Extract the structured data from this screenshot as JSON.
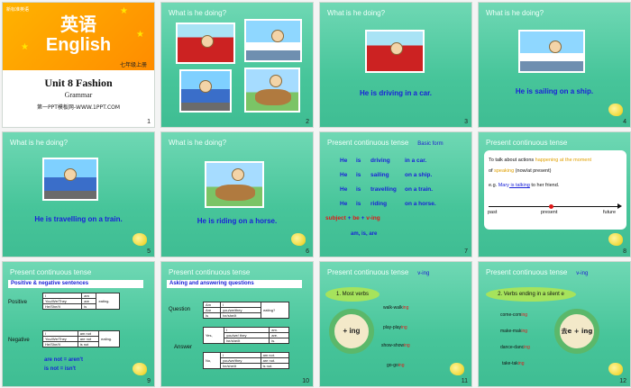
{
  "slides": [
    {
      "num": "1",
      "title_cn": "英语",
      "title_en": "English",
      "grade": "七年级上册",
      "unit": "Unit 8 Fashion",
      "sub": "Grammar",
      "site": "第一PPT模板网-WWW.1PPT.COM",
      "logo": "新标准英语"
    },
    {
      "num": "2",
      "header": "What is he doing?"
    },
    {
      "num": "3",
      "header": "What is he doing?",
      "sentence": "He is driving in a car."
    },
    {
      "num": "4",
      "header": "What is he doing?",
      "sentence": "He is sailing on a ship."
    },
    {
      "num": "5",
      "header": "What is he doing?",
      "sentence": "He is travelling on a train."
    },
    {
      "num": "6",
      "header": "What is he doing?",
      "sentence": "He is riding on a horse."
    },
    {
      "num": "7",
      "header": "Present continuous tense",
      "subheader": "Basic form",
      "rows": [
        [
          "He",
          "is",
          "driving",
          "in a car."
        ],
        [
          "He",
          "is",
          "sailing",
          "on a ship."
        ],
        [
          "He",
          "is",
          "travelling",
          "on a train."
        ],
        [
          "He",
          "is",
          "riding",
          "on a horse."
        ]
      ],
      "formula": [
        "subject",
        "+",
        "be",
        "+",
        "v-ing"
      ],
      "be_forms": "am, is, are"
    },
    {
      "num": "8",
      "header": "Present continuous tense",
      "line1a": "To talk about actions ",
      "line1b": "happening at the moment",
      "line2a": "of ",
      "line2b": "speaking",
      "line2c": " (now/at present)",
      "eg_a": "e.g. ",
      "eg_b": "Mary",
      "eg_c": " is talking",
      "eg_d": " to her friend.",
      "past": "past",
      "present": "present",
      "future": "future"
    },
    {
      "num": "9",
      "header": "Present continuous tense",
      "bar": "Positive & negative sentences",
      "positive": "Positive",
      "negative": "Negative",
      "pos_rows": [
        [
          "I",
          "am"
        ],
        [
          "You/We/They",
          "are"
        ],
        [
          "He/She/It",
          "is"
        ]
      ],
      "pos_right": "eating.",
      "neg_rows": [
        [
          "I",
          "am not"
        ],
        [
          "You/We/They",
          "are not"
        ],
        [
          "He/She/It",
          "is not"
        ]
      ],
      "neg_right": "eating.",
      "contr1": "are not = aren't",
      "contr2": "is not = isn't"
    },
    {
      "num": "10",
      "header": "Present continuous tense",
      "bar": "Asking and answering questions",
      "question": "Question",
      "answer": "Answer",
      "yes": "Yes,",
      "no": "No,",
      "q_rows": [
        [
          "Am",
          "I"
        ],
        [
          "Are",
          "you/we/they"
        ],
        [
          "Is",
          "he/she/it"
        ]
      ],
      "q_right": "eating?",
      "y_rows": [
        [
          "I",
          "am."
        ],
        [
          "you/we/ they",
          "are."
        ],
        [
          "he/she/it",
          "is."
        ]
      ],
      "n_rows": [
        [
          "I",
          "am not."
        ],
        [
          "you/we/they",
          "are not."
        ],
        [
          "he/she/it",
          "is not."
        ]
      ]
    },
    {
      "num": "11",
      "header": "Present continuous tense",
      "subheader": "v-ing",
      "leaf": "1. Most verbs",
      "circle": "+ ing",
      "ex": [
        [
          "walk-walk",
          "ing"
        ],
        [
          "play-play",
          "ing"
        ],
        [
          "show-show",
          "ing"
        ],
        [
          "go-go",
          "ing"
        ]
      ]
    },
    {
      "num": "12",
      "header": "Present continuous tense",
      "subheader": "v-ing",
      "leaf": "2. Verbs ending in a silent e",
      "circle": "去e + ing",
      "ex": [
        [
          "come-com",
          "ing"
        ],
        [
          "make-mak",
          "ing"
        ],
        [
          "dance-danc",
          "ing"
        ],
        [
          "take-tak",
          "ing"
        ]
      ]
    }
  ]
}
